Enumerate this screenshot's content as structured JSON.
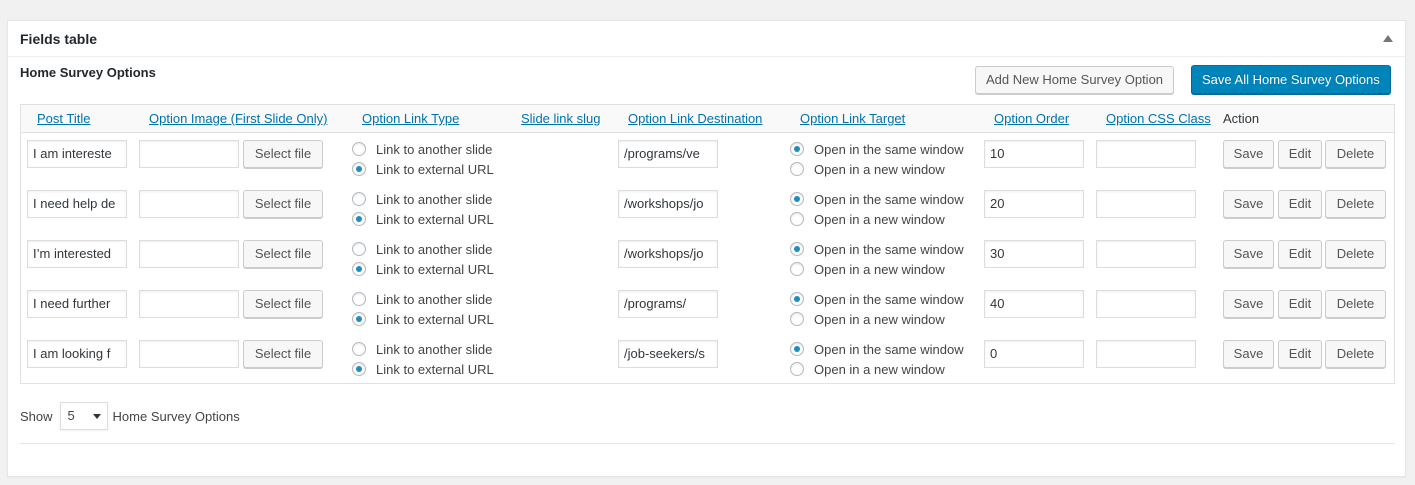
{
  "panel": {
    "title": "Fields table"
  },
  "section": {
    "title": "Home Survey Options",
    "add_label": "Add New Home Survey Option",
    "save_all_label": "Save All Home Survey Options"
  },
  "columns": {
    "post_title": "Post Title",
    "option_image": "Option Image (First Slide Only)",
    "link_type": "Option Link Type",
    "slide_slug": "Slide link slug",
    "link_destination": "Option Link Destination",
    "link_target": "Option Link Target",
    "option_order": "Option Order",
    "css_class": "Option CSS Class",
    "action": "Action"
  },
  "labels": {
    "select_file": "Select file",
    "link_slide": "Link to another slide",
    "link_external": "Link to external URL",
    "target_same": "Open in the same window",
    "target_new": "Open in a new window",
    "save": "Save",
    "edit": "Edit",
    "delete": "Delete"
  },
  "rows": [
    {
      "title": "I am intereste",
      "destination": "/programs/ve",
      "order": "10",
      "link_type": "external",
      "target": "same"
    },
    {
      "title": "I need help de",
      "destination": "/workshops/jo",
      "order": "20",
      "link_type": "external",
      "target": "same"
    },
    {
      "title": "I’m interested",
      "destination": "/workshops/jo",
      "order": "30",
      "link_type": "external",
      "target": "same"
    },
    {
      "title": "I need further",
      "destination": "/programs/",
      "order": "40",
      "link_type": "external",
      "target": "same"
    },
    {
      "title": "I am looking f",
      "destination": "/job-seekers/s",
      "order": "0",
      "link_type": "external",
      "target": "same"
    }
  ],
  "pagination": {
    "show_label": "Show",
    "per_page": "5",
    "suffix": "Home Survey Options"
  }
}
